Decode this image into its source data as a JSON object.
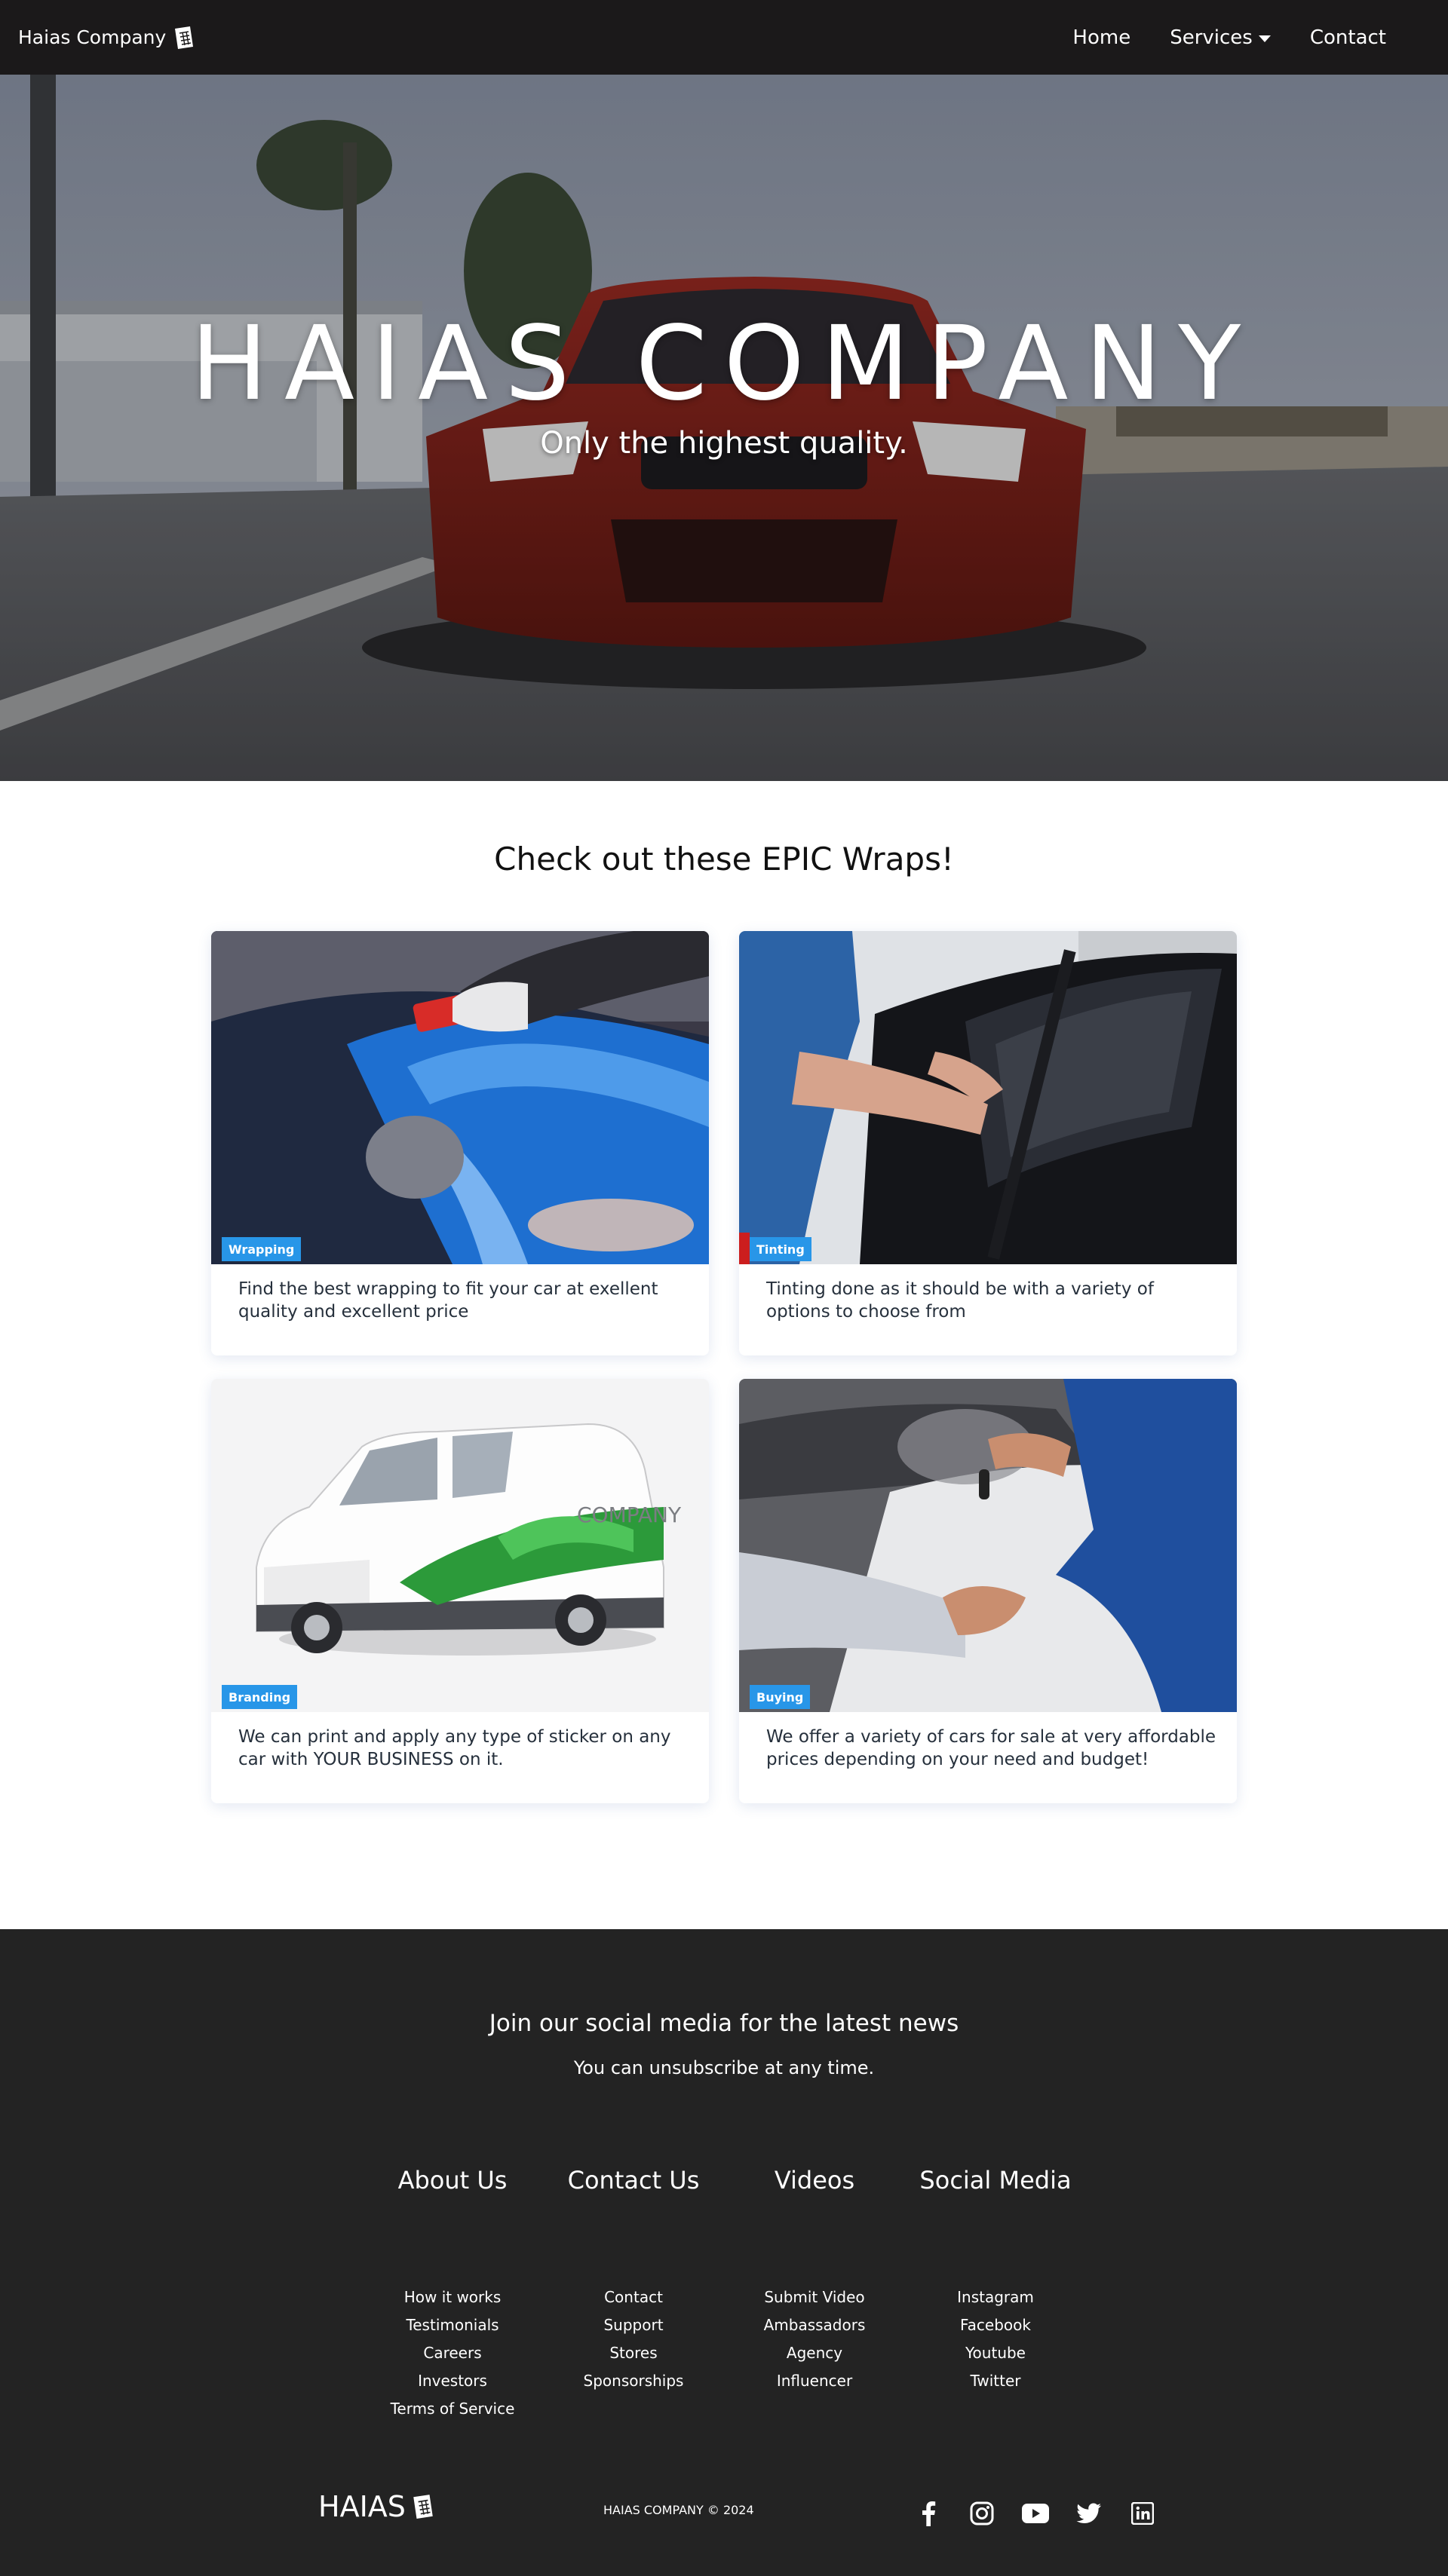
{
  "nav": {
    "brand": "Haias Company",
    "links": [
      {
        "label": "Home"
      },
      {
        "label": "Services"
      },
      {
        "label": "Contact"
      }
    ]
  },
  "hero": {
    "title": "HAIAS COMPANY",
    "subtitle": "Only the highest quality."
  },
  "wraps": {
    "title": "Check out these EPIC Wraps!",
    "cards": [
      {
        "badge": "Wrapping",
        "text": "Find the best wrapping to fit your car at exellent quality and excellent price"
      },
      {
        "badge": "Tinting",
        "text": "Tinting done as it should be with a variety of options to choose from"
      },
      {
        "badge": "Branding",
        "text": "We can print and apply any type of sticker on any car with YOUR BUSINESS on it."
      },
      {
        "badge": "Buying",
        "text": "We offer a variety of cars for sale at very affordable prices depending on your need and budget!"
      }
    ],
    "van_text": "COMPANY"
  },
  "footer": {
    "join": "Join our social media for the latest news",
    "unsubscribe": "You can unsubscribe at any time.",
    "columns": [
      {
        "title": "About Us",
        "items": [
          "How it works",
          "Testimonials",
          "Careers",
          "Investors",
          "Terms of Service"
        ]
      },
      {
        "title": "Contact Us",
        "items": [
          "Contact",
          "Support",
          "Stores",
          "Sponsorships"
        ]
      },
      {
        "title": "Videos",
        "items": [
          "Submit Video",
          "Ambassadors",
          "Agency",
          "Influencer"
        ]
      },
      {
        "title": "Social Media",
        "items": [
          "Instagram",
          "Facebook",
          "Youtube",
          "Twitter"
        ]
      }
    ],
    "logo": "HAIAS",
    "copyright": "HAIAS COMPANY © 2024",
    "social_icons": [
      "facebook-icon",
      "instagram-icon",
      "youtube-icon",
      "twitter-icon",
      "linkedin-icon"
    ]
  },
  "colors": {
    "navbar": "#1b191a",
    "footer": "#232323",
    "badge": "#2896e8"
  }
}
